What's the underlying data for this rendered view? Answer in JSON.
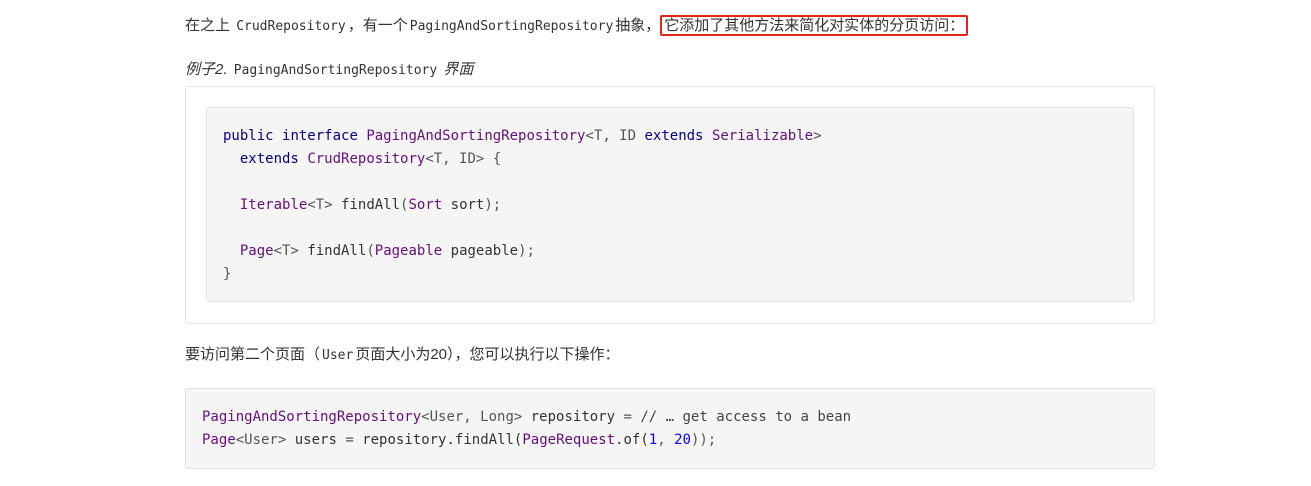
{
  "para1": {
    "prefix": "在之上",
    "code1": "CrudRepository",
    "mid": "，有一个",
    "code2": "PagingAndSortingRepository",
    "suffix": "抽象，",
    "highlight": "它添加了其他方法来简化对实体的分页访问："
  },
  "caption": {
    "prefix": "例子2.",
    "code": "PagingAndSortingRepository",
    "suffix": "界面"
  },
  "code_block_1": {
    "l1_kw1": "public",
    "l1_kw2": "interface",
    "l1_name": "PagingAndSortingRepository",
    "l1_gen": "<T, ID",
    "l1_kw3": "extends",
    "l1_ser": "Serializable",
    "l1_close": ">",
    "l2_kw": "extends",
    "l2_name": "CrudRepository",
    "l2_gen": "<T, ID>",
    "l2_brace": "{",
    "l4_type": "Iterable",
    "l4_gen": "<T>",
    "l4_method": "findAll",
    "l4_argtype": "Sort",
    "l4_arg": "sort",
    "l4_end": ");",
    "l6_type": "Page",
    "l6_gen": "<T>",
    "l6_method": "findAll",
    "l6_argtype": "Pageable",
    "l6_arg": "pageable",
    "l6_end": ");",
    "l7": "}"
  },
  "para2": {
    "prefix": "要访问第二个页面（",
    "code": "User",
    "suffix": "页面大小为20），您可以执行以下操作："
  },
  "code_block_2": {
    "l1_type": "PagingAndSortingRepository",
    "l1_gen": "<User, Long>",
    "l1_var": "repository",
    "l1_eq": "=",
    "l1_comment": "// … get access to a bean",
    "l2_type": "Page",
    "l2_gen": "<User>",
    "l2_var": "users",
    "l2_eq": "=",
    "l2_call": "repository.findAll(",
    "l2_req": "PageRequest",
    "l2_of": ".of(",
    "l2_n1": "1",
    "l2_comma": ", ",
    "l2_n2": "20",
    "l2_end": "));"
  }
}
